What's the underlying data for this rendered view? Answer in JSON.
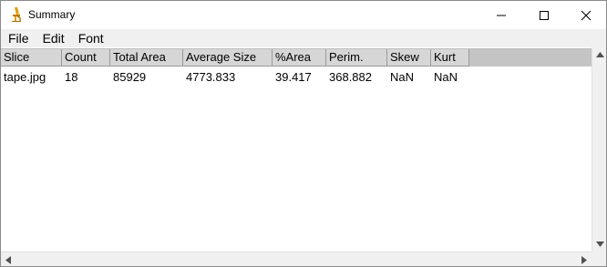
{
  "window": {
    "title": "Summary",
    "icon": "microscope-icon"
  },
  "menu": {
    "items": [
      "File",
      "Edit",
      "Font"
    ]
  },
  "table": {
    "columns": [
      "Slice",
      "Count",
      "Total Area",
      "Average Size",
      "%Area",
      "Perim.",
      "Skew",
      "Kurt"
    ],
    "rows": [
      [
        "tape.jpg",
        "18",
        "85929",
        "4773.833",
        "39.417",
        "368.882",
        "NaN",
        "NaN"
      ]
    ]
  }
}
